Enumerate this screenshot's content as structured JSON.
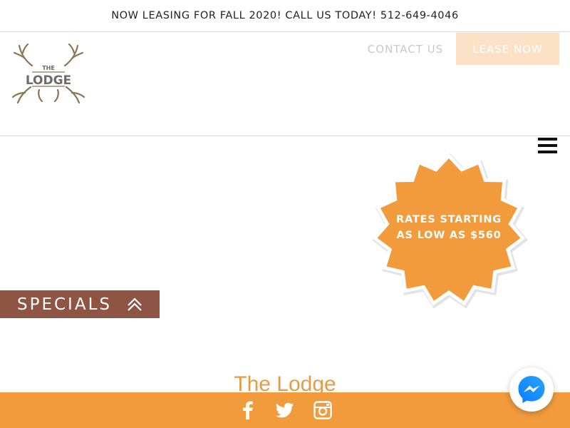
{
  "announcement": {
    "text": "NOW LEASING FOR FALL 2020! CALL US TODAY! 512-649-4046"
  },
  "header": {
    "logo_text": "THE LODGE",
    "logo_small": "THE",
    "logo_big": "LODGE",
    "contact_label": "CONTACT US",
    "lease_label": "LEASE NOW"
  },
  "promo": {
    "line1": "RATES STARTING",
    "line2": "AS LOW AS $560"
  },
  "specials": {
    "label": "SPECIALS"
  },
  "main": {
    "title": "The Lodge"
  },
  "colors": {
    "brand_orange": "#f19b3d",
    "specials_brown": "#8e5545",
    "lease_bg": "#fbe2c7",
    "logo_brown": "#8c7456"
  },
  "icons": {
    "facebook": "facebook-icon",
    "twitter": "twitter-icon",
    "instagram": "instagram-icon",
    "messenger": "messenger-icon",
    "menu": "hamburger-menu-icon",
    "specials": "double-chevron-up-icon"
  }
}
